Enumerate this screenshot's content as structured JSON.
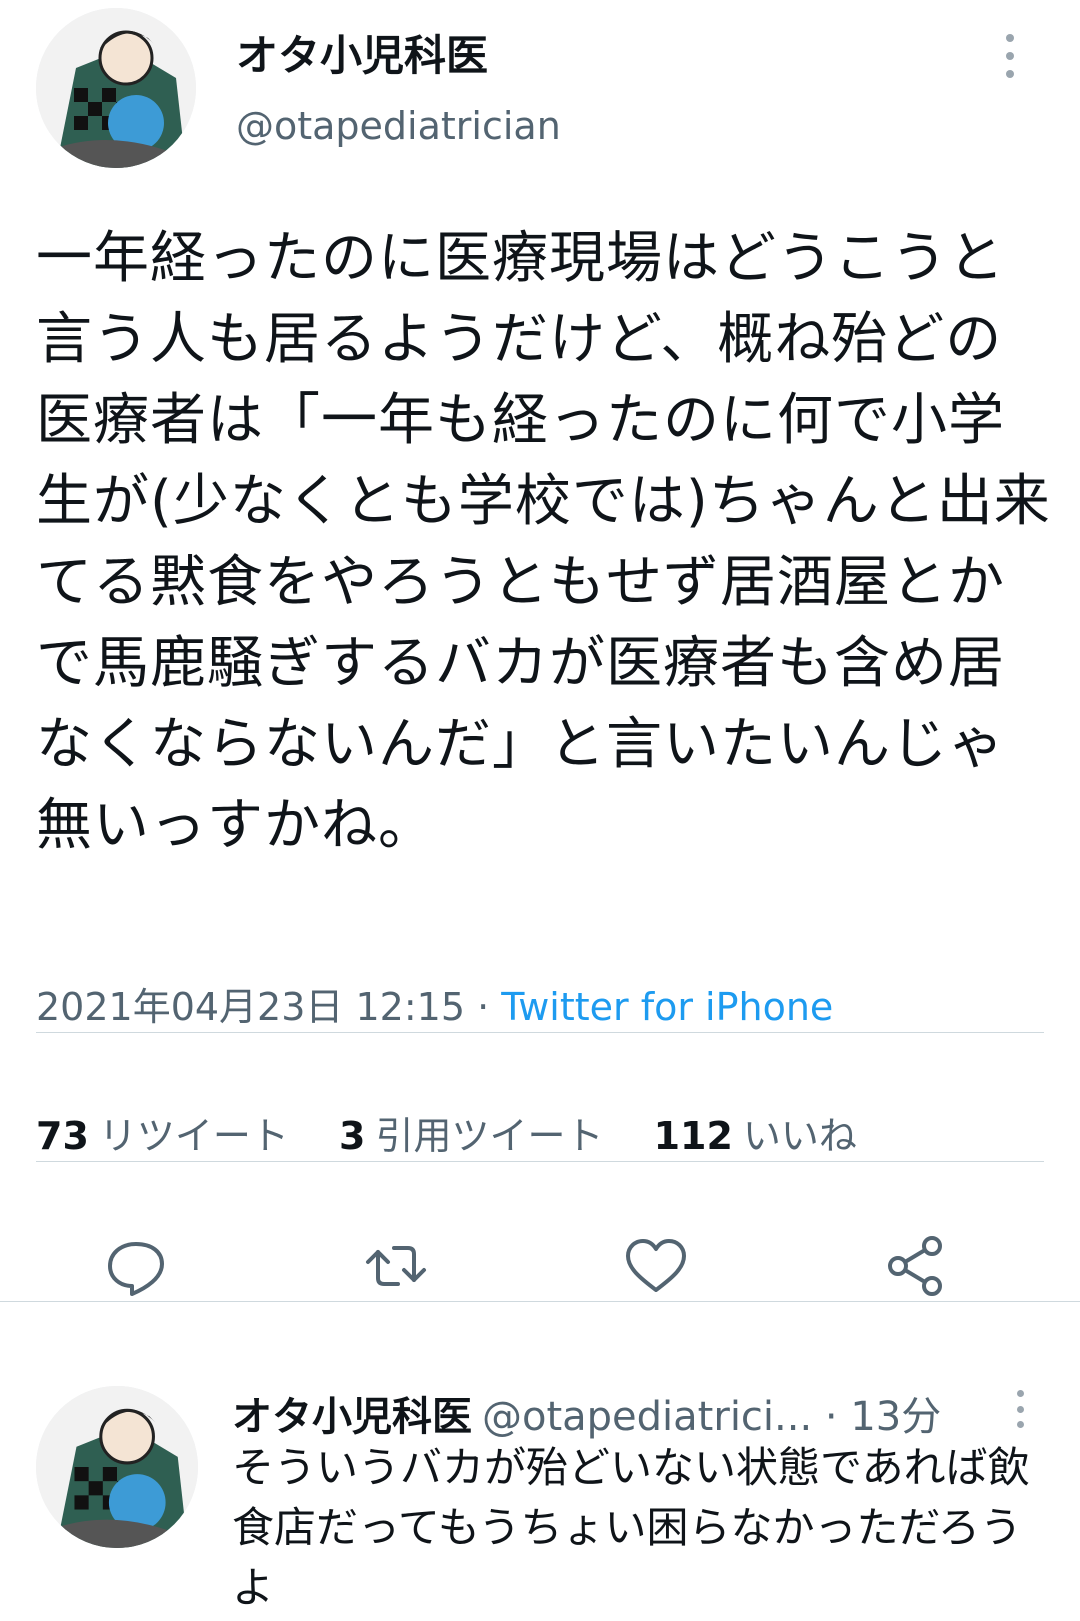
{
  "tweet": {
    "display_name": "オタ小児科医",
    "handle": "@otapediatrician",
    "text": "一年経ったのに医療現場はどうこうと言う人も居るようだけど、概ね殆どの医療者は「一年も経ったのに何で小学生が(少なくとも学校では)ちゃんと出来てる黙食をやろうともせず居酒屋とかで馬鹿騒ぎするバカが医療者も含め居なくならないんだ」と言いたいんじゃ無いっすかね。",
    "timestamp": "2021年04月23日 12:15",
    "separator": " · ",
    "source": "Twitter for iPhone"
  },
  "stats": {
    "retweets_count": "73",
    "retweets_label": "リツイート",
    "quotes_count": "3",
    "quotes_label": "引用ツイート",
    "likes_count": "112",
    "likes_label": "いいね"
  },
  "actions": {
    "icons": [
      "reply-icon",
      "retweet-icon",
      "like-icon",
      "share-icon"
    ],
    "icon_color": "#536471"
  },
  "reply": {
    "display_name": "オタ小児科医",
    "handle": "@otapediatrici...",
    "time": "· 13分",
    "text": "そういうバカが殆どいない状態であれば飲食店だってもうちょい困らなかっただろうよ"
  },
  "colors": {
    "text": "#0f1419",
    "secondary": "#536471",
    "link": "#1d9bf0",
    "divider": "#cfd9de"
  }
}
